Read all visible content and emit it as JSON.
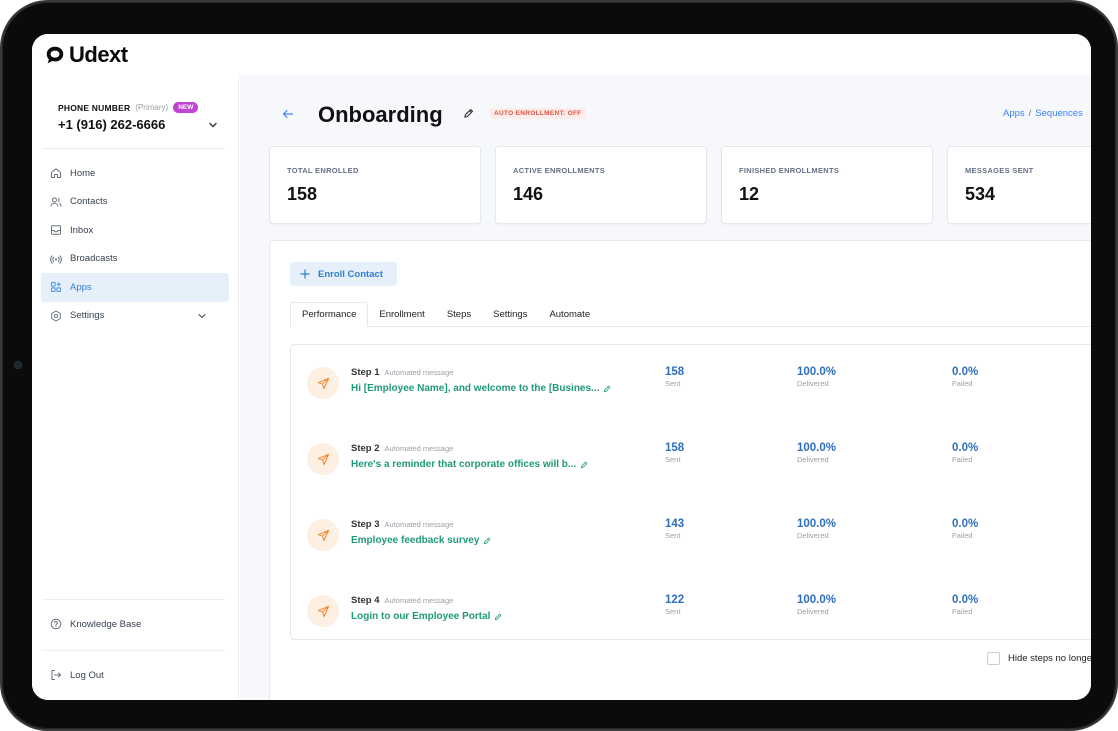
{
  "app": {
    "name": "Udext"
  },
  "sidebar": {
    "phone_label": "PHONE NUMBER",
    "phone_primary": "(Primary)",
    "phone_badge": "NEW",
    "phone_number": "+1 (916) 262-6666",
    "items": [
      {
        "label": "Home",
        "icon": "home-icon"
      },
      {
        "label": "Contacts",
        "icon": "contacts-icon"
      },
      {
        "label": "Inbox",
        "icon": "inbox-icon"
      },
      {
        "label": "Broadcasts",
        "icon": "broadcast-icon"
      },
      {
        "label": "Apps",
        "icon": "apps-icon",
        "active": true
      },
      {
        "label": "Settings",
        "icon": "settings-icon"
      }
    ],
    "knowledge_base": "Knowledge Base",
    "logout": "Log Out"
  },
  "header": {
    "title": "Onboarding",
    "auto_enrollment": "AUTO ENROLLMENT: OFF",
    "breadcrumb": [
      "Apps",
      "Sequences"
    ]
  },
  "stats": [
    {
      "label": "TOTAL ENROLLED",
      "value": "158"
    },
    {
      "label": "ACTIVE ENROLLMENTS",
      "value": "146"
    },
    {
      "label": "FINISHED ENROLLMENTS",
      "value": "12"
    },
    {
      "label": "MESSAGES SENT",
      "value": "534"
    }
  ],
  "enroll_button": "Enroll Contact",
  "tabs": [
    "Performance",
    "Enrollment",
    "Steps",
    "Settings",
    "Automate"
  ],
  "steps": [
    {
      "name": "Step 1",
      "type": "Automated message",
      "message": "Hi [Employee Name], and welcome to the [Busines...",
      "sent": "158",
      "sent_label": "Sent",
      "delivered": "100.0%",
      "delivered_label": "Delivered",
      "failed": "0.0%",
      "failed_label": "Failed"
    },
    {
      "name": "Step 2",
      "type": "Automated message",
      "message": "Here's a reminder that corporate offices will b...",
      "sent": "158",
      "sent_label": "Sent",
      "delivered": "100.0%",
      "delivered_label": "Delivered",
      "failed": "0.0%",
      "failed_label": "Failed"
    },
    {
      "name": "Step 3",
      "type": "Automated message",
      "message": "Employee feedback survey",
      "sent": "143",
      "sent_label": "Sent",
      "delivered": "100.0%",
      "delivered_label": "Delivered",
      "failed": "0.0%",
      "failed_label": "Failed"
    },
    {
      "name": "Step 4",
      "type": "Automated message",
      "message": "Login to our Employee Portal",
      "sent": "122",
      "sent_label": "Sent",
      "delivered": "100.0%",
      "delivered_label": "Delivered",
      "failed": "0.0%",
      "failed_label": "Failed"
    }
  ],
  "hide_steps_label": "Hide steps no longe",
  "colors": {
    "accent": "#2f7fd1",
    "message_link": "#1f9a7a",
    "metric": "#2d6fbe",
    "badge_new": "#c043d4",
    "auto_badge": "#e0533d"
  }
}
